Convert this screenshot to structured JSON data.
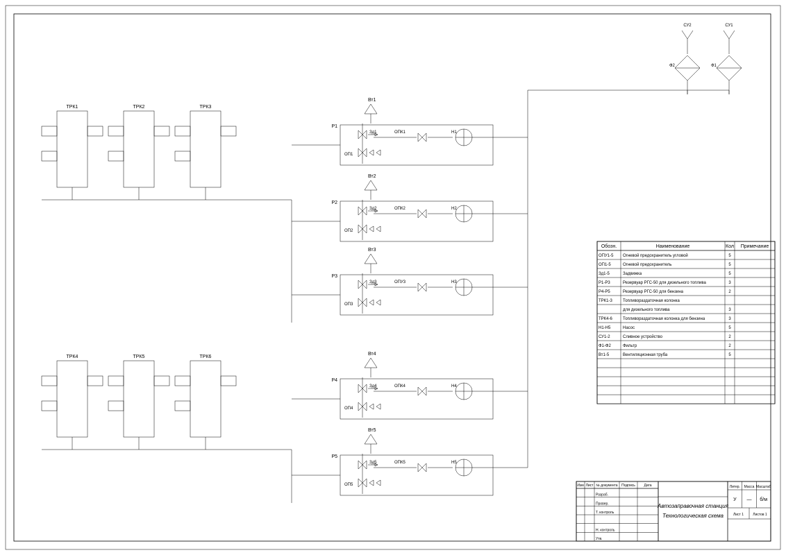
{
  "trk_top": [
    "ТРК1",
    "ТРК2",
    "ТРК3"
  ],
  "trk_bottom": [
    "ТРК4",
    "ТРК5",
    "ТРК6"
  ],
  "reservoirs": [
    {
      "p": "Р1",
      "vt": "Вт1",
      "zd": "Зд1",
      "op": "ОП1",
      "opk": "ОПК1",
      "n": "Н1"
    },
    {
      "p": "Р2",
      "vt": "Вт2",
      "zd": "Зд2",
      "op": "ОП2",
      "opk": "ОПК2",
      "n": "Н2"
    },
    {
      "p": "Р3",
      "vt": "Вт3",
      "zd": "Зд3",
      "op": "ОП3",
      "opk": "ОПУ3",
      "n": "Н3"
    },
    {
      "p": "Р4",
      "vt": "Вт4",
      "zd": "Зд4",
      "op": "ОП4",
      "opk": "ОПК4",
      "n": "Н4"
    },
    {
      "p": "Р5",
      "vt": "Вт5",
      "zd": "Зд5",
      "op": "ОП5",
      "opk": "ОПК5",
      "n": "Н5"
    }
  ],
  "filters": [
    {
      "su": "СУ2",
      "f": "Ф2"
    },
    {
      "su": "СУ1",
      "f": "Ф1"
    }
  ],
  "parts_table": {
    "headers": {
      "code": "Обозн.",
      "name": "Наименование",
      "qty": "Кол",
      "note": "Примечание"
    },
    "rows": [
      {
        "code": "ОПУ1-5",
        "name": "Огневой предохранитель угловой",
        "qty": "5",
        "note": ""
      },
      {
        "code": "ОП1-5",
        "name": "Огневой предохранитель",
        "qty": "5",
        "note": ""
      },
      {
        "code": "Зд1-5",
        "name": "Задвижка",
        "qty": "5",
        "note": ""
      },
      {
        "code": "Р1-Р3",
        "name": "Резервуар РГС-50 для дизельного топлива",
        "qty": "3",
        "note": ""
      },
      {
        "code": "Р4-Р5",
        "name": "Резервуар РГС-50 для бензина",
        "qty": "2",
        "note": ""
      },
      {
        "code": "ТРК1-3",
        "name": "Топливораздаточная колонка",
        "qty": "",
        "note": ""
      },
      {
        "code": "",
        "name": "для дизельного топлива",
        "qty": "3",
        "note": ""
      },
      {
        "code": "ТРК4-6",
        "name": "Топливораздаточная колонка для бензина",
        "qty": "3",
        "note": ""
      },
      {
        "code": "Н1-Н5",
        "name": "Насос",
        "qty": "5",
        "note": ""
      },
      {
        "code": "СУ1-2",
        "name": "Сливное устройство",
        "qty": "2",
        "note": ""
      },
      {
        "code": "Ф1-Ф2",
        "name": "Фильтр",
        "qty": "2",
        "note": ""
      },
      {
        "code": "Вт1-5",
        "name": "Вентиляционная труба",
        "qty": "5",
        "note": ""
      }
    ]
  },
  "title_block": {
    "line1": "Автозаправочная станция",
    "line2": "Технологическая схема",
    "left_rows": [
      "Разраб.",
      "Провер.",
      "Т. контроль",
      "",
      "Н. контроль",
      "Утв."
    ],
    "left_headers": [
      "Изм",
      "Лист",
      "№ документа",
      "Подпись",
      "Дата"
    ],
    "right_headers": [
      "Литер.",
      "Масса",
      "Масштаб"
    ],
    "stage": "У",
    "mass": "—",
    "scale": "б/м",
    "sheet": "Лист 1",
    "sheets": "Листов 1"
  }
}
